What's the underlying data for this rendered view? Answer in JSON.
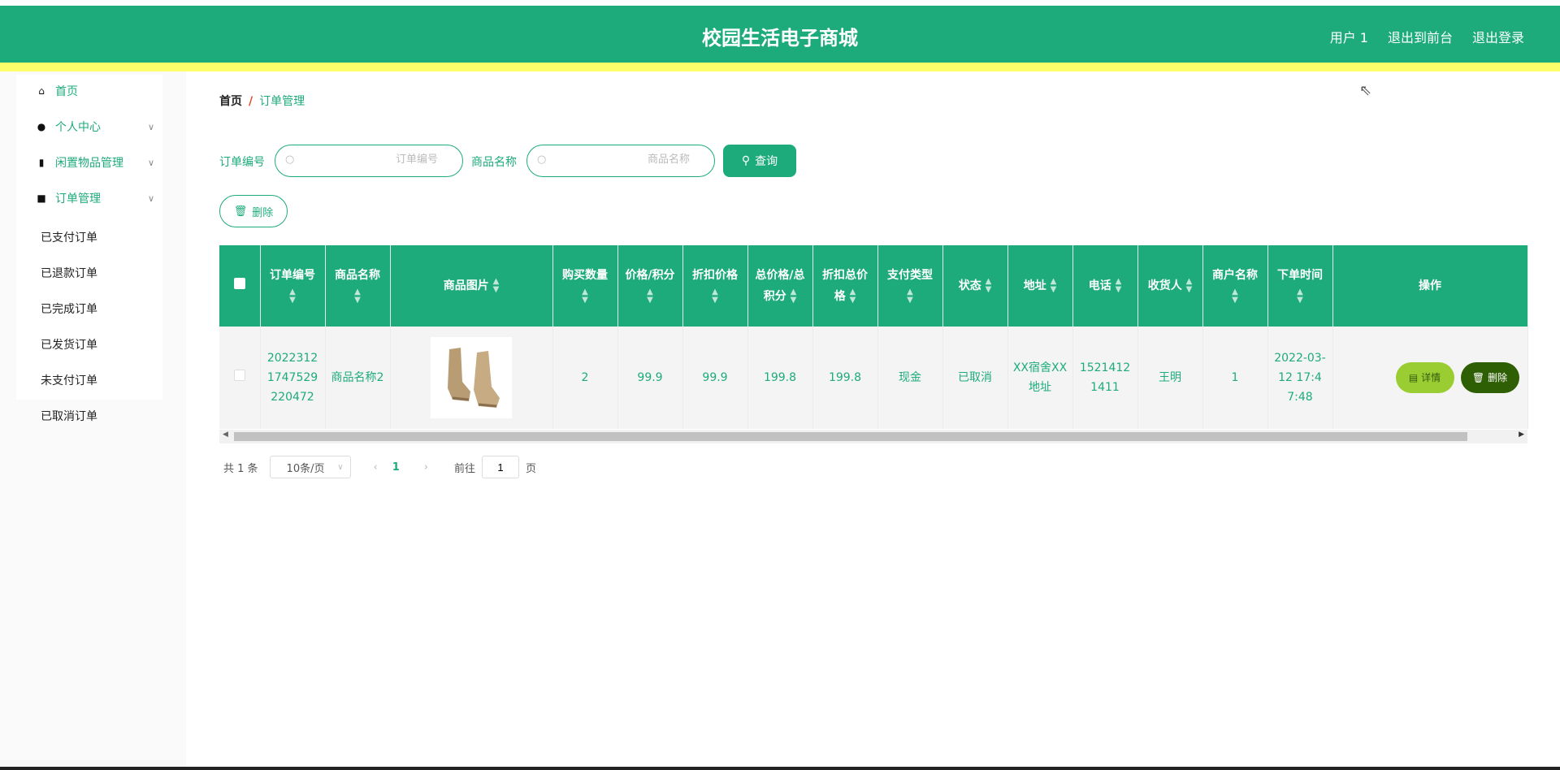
{
  "header": {
    "title": "校园生活电子商城",
    "links": [
      "用户 1",
      "退出到前台",
      "退出登录"
    ]
  },
  "sidebar": {
    "items": [
      {
        "label": "首页",
        "icon": "home-icon"
      },
      {
        "label": "个人中心",
        "icon": "user-icon"
      },
      {
        "label": "闲置物品管理",
        "icon": "ticket-icon"
      },
      {
        "label": "订单管理",
        "icon": "cart-icon"
      }
    ],
    "sub_items": [
      "已支付订单",
      "已退款订单",
      "已完成订单",
      "已发货订单",
      "未支付订单",
      "已取消订单"
    ]
  },
  "breadcrumb": {
    "home": "首页",
    "current": "订单管理"
  },
  "search": {
    "order_label": "订单编号",
    "order_placeholder": "订单编号",
    "name_label": "商品名称",
    "name_placeholder": "商品名称",
    "query_label": "查询",
    "delete_label": "删除"
  },
  "table": {
    "headers": [
      "订单编号",
      "商品名称",
      "商品图片",
      "购买数量",
      "价格/积分",
      "折扣价格",
      "总价格/总积分",
      "折扣总价格",
      "支付类型",
      "状态",
      "地址",
      "电话",
      "收货人",
      "商户名称",
      "下单时间",
      "操作"
    ],
    "rows": [
      {
        "cells": [
          "20223121747529220472",
          "商品名称2",
          "",
          "2",
          "99.9",
          "99.9",
          "199.8",
          "199.8",
          "现金",
          "已取消",
          "XX宿舍XX地址",
          "15214121411",
          "王明",
          "1",
          "2022-03-12 17:47:48"
        ],
        "detail": "详情",
        "delete": "删除"
      }
    ]
  },
  "pagination": {
    "total": "共 1 条",
    "page_size": "10条/页",
    "current": "1",
    "goto": "前往",
    "goto_value": "1",
    "page_suffix": "页"
  },
  "colors": {
    "primary": "#1dab7b",
    "accent": "#fefe6b",
    "detail_btn": "#9acd32",
    "delete_btn": "#2f5f05"
  }
}
